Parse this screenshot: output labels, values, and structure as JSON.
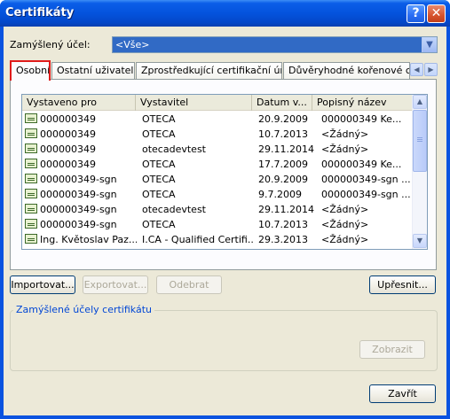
{
  "window": {
    "title": "Certifikáty",
    "help_glyph": "?",
    "close_glyph": "✕"
  },
  "purpose": {
    "label": "Zamýšlený účel:",
    "value": "<Vše>",
    "arrow": "▼"
  },
  "tabs": [
    {
      "label": "Osobní"
    },
    {
      "label": "Ostatní uživatelé"
    },
    {
      "label": "Zprostředkující certifikační úřady"
    },
    {
      "label": "Důvěryhodné kořenové certifikační úřady"
    }
  ],
  "tab_scroll": {
    "left": "◀",
    "right": "▶"
  },
  "list": {
    "columns": [
      "Vystaveno pro",
      "Vystavitel",
      "Datum v...",
      "Popisný název"
    ],
    "rows": [
      [
        "000000349",
        "OTECA",
        "20.9.2009",
        "000000349    Ke..."
      ],
      [
        "000000349",
        "OTECA",
        "10.7.2013",
        "<Žádný>"
      ],
      [
        "000000349",
        "otecadevtest",
        "29.11.2014",
        "<Žádný>"
      ],
      [
        "000000349",
        "OTECA",
        "17.7.2009",
        "000000349    Ke..."
      ],
      [
        "000000349-sgn",
        "OTECA",
        "20.9.2009",
        "000000349-sgn  ..."
      ],
      [
        "000000349-sgn",
        "OTECA",
        "9.7.2009",
        "000000349-sgn  ..."
      ],
      [
        "000000349-sgn",
        "otecadevtest",
        "29.11.2014",
        "<Žádný>"
      ],
      [
        "000000349-sgn",
        "OTECA",
        "10.7.2013",
        "<Žádný>"
      ],
      [
        "Ing. Květoslav Paz...",
        "I.CA - Qualified Certifi...",
        "29.3.2013",
        "<Žádný>"
      ]
    ],
    "scroll_up": "▲",
    "scroll_down": "▼"
  },
  "buttons": {
    "import": "Importovat...",
    "export": "Exportovat...",
    "remove": "Odebrat",
    "advanced": "Upřesnit...",
    "view": "Zobrazit",
    "close": "Zavřít"
  },
  "group": {
    "legend": "Zamýšlené účely certifikátu"
  }
}
